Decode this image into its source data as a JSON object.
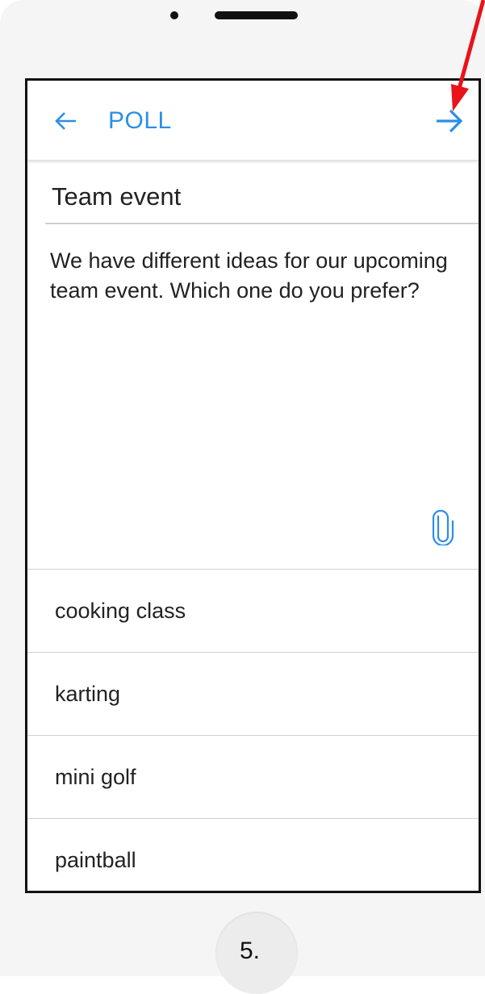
{
  "appbar": {
    "title": "POLL",
    "back_icon": "arrow-left-icon",
    "next_icon": "arrow-right-icon",
    "accent_color": "#2b8fe6"
  },
  "poll": {
    "title": "Team event",
    "description": "We have different ideas for our upcoming team event. Which one do you prefer?",
    "attachment_icon": "paperclip-icon",
    "options": [
      {
        "label": "cooking class"
      },
      {
        "label": "karting"
      },
      {
        "label": "mini golf"
      },
      {
        "label": "paintball"
      }
    ]
  },
  "annotation": {
    "step": "5.",
    "pointer_color": "#e8131b"
  }
}
